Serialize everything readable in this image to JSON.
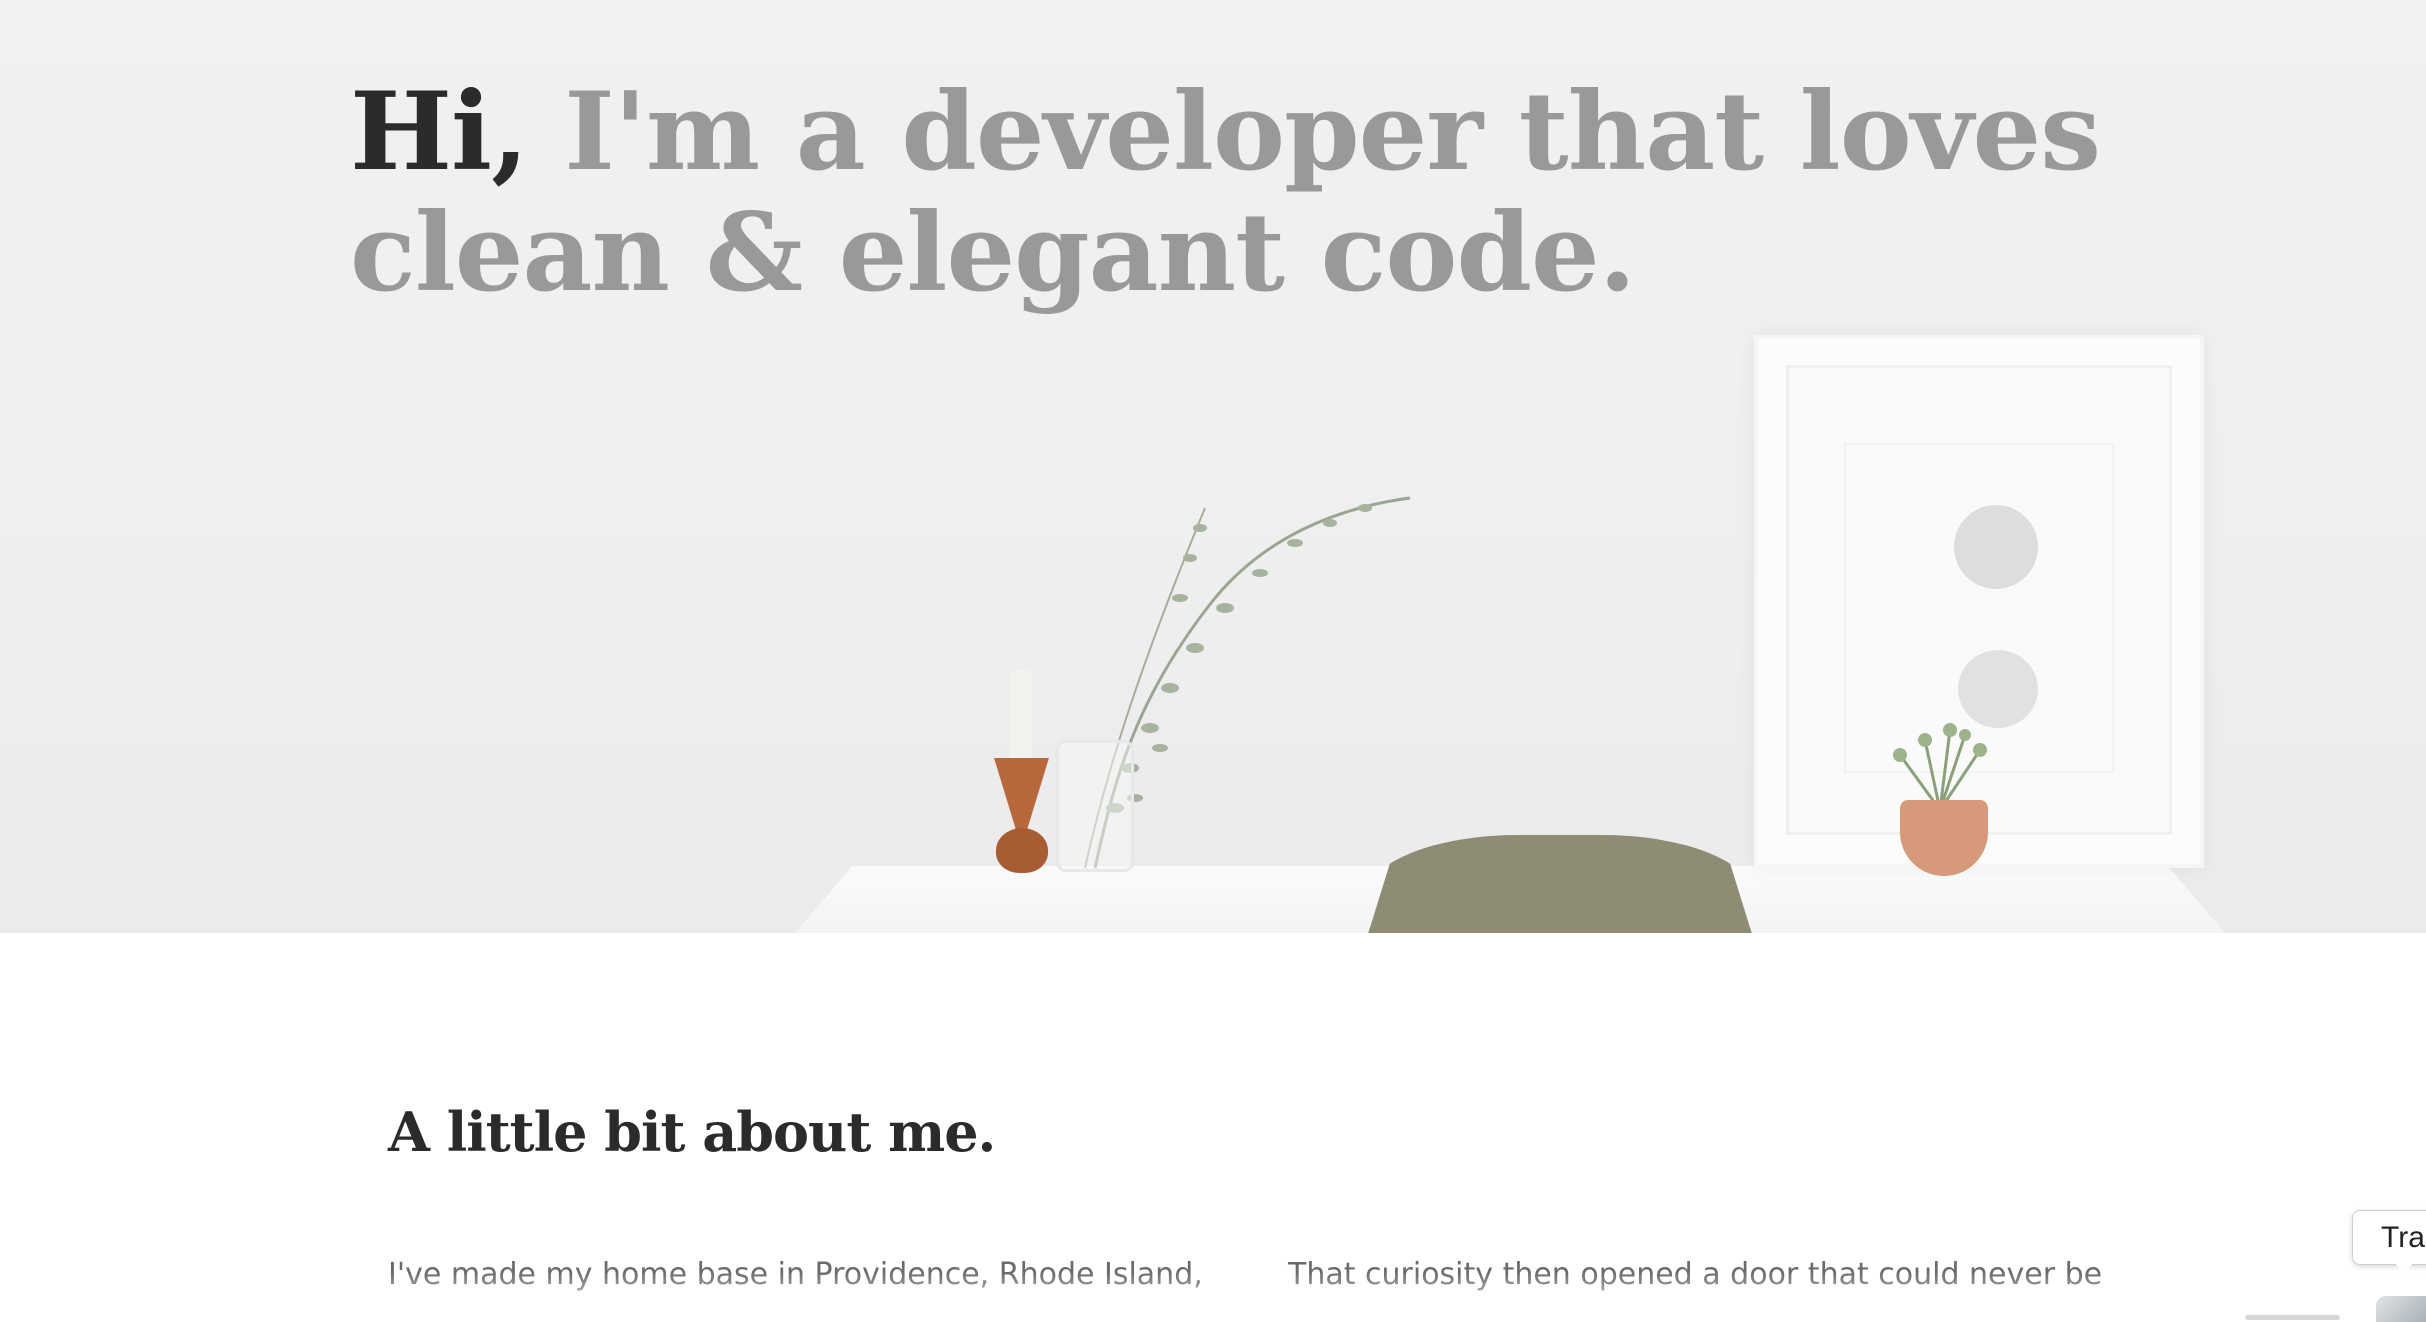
{
  "hero": {
    "greeting": "Hi",
    "comma": ",",
    "title_line1": " I'm a developer that loves",
    "title_line2": "clean & elegant code."
  },
  "about": {
    "heading": "A little bit about me.",
    "para_left": "I've made my home base in Providence, Rhode Island,",
    "para_right": "That curiosity then opened a door that could never be"
  },
  "dock": {
    "tooltip": "Trash",
    "icon": "trash-icon"
  },
  "colors": {
    "title_dark": "#2b2b2b",
    "title_muted": "#999999",
    "body_text": "#6b6b6b"
  }
}
